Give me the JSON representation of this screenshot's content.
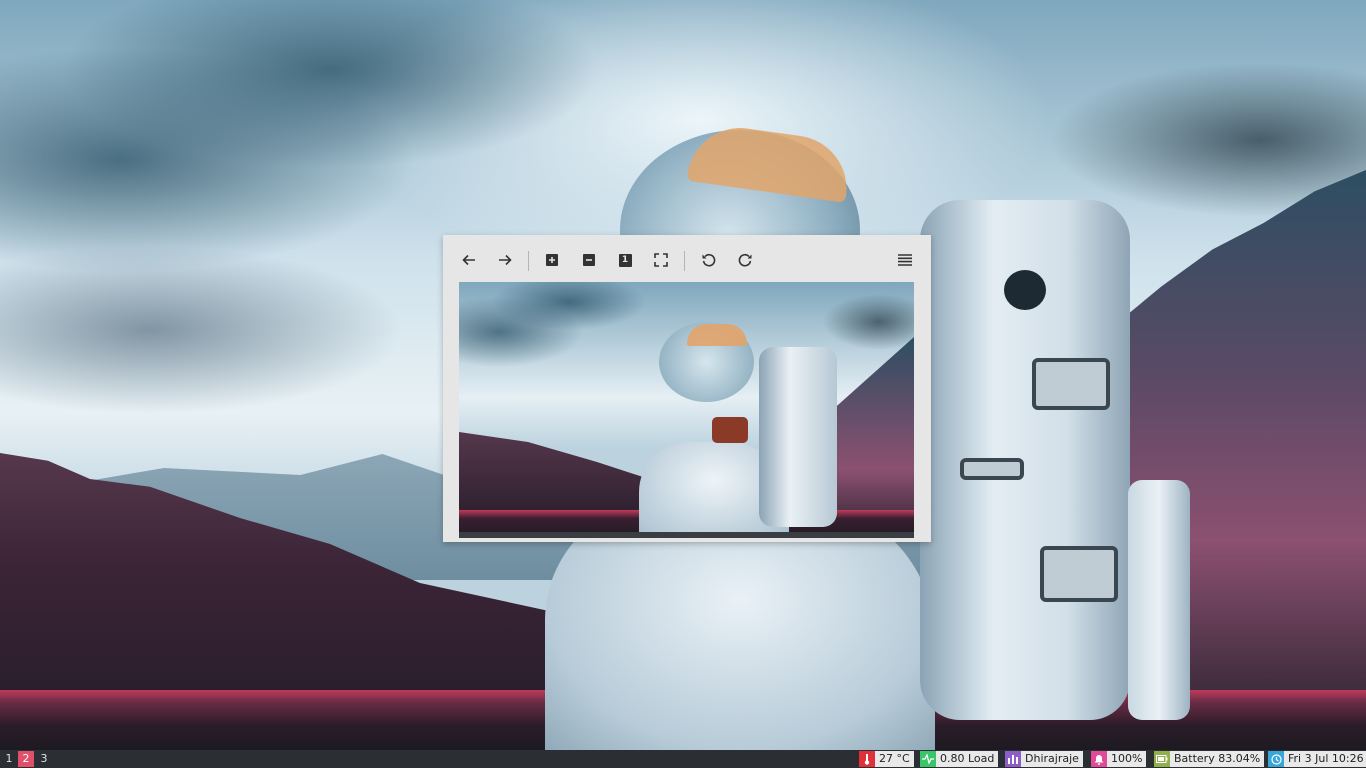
{
  "viewer": {
    "toolbar": {
      "back_icon": "arrow-left-icon",
      "forward_icon": "arrow-right-icon",
      "zoom_in_icon": "zoom-in-icon",
      "zoom_out_icon": "zoom-out-icon",
      "original_size_label": "1",
      "fit_icon": "fullscreen-icon",
      "rotate_left_icon": "rotate-left-icon",
      "rotate_right_icon": "rotate-right-icon",
      "menu_icon": "menu-icon"
    }
  },
  "panel": {
    "workspaces": [
      {
        "label": "1",
        "active": false
      },
      {
        "label": "2",
        "active": true
      },
      {
        "label": "3",
        "active": false
      }
    ],
    "temperature": {
      "text": "27 °C",
      "color": "#e0303a",
      "icon": "thermometer-icon"
    },
    "load": {
      "text": "0.80 Load",
      "color": "#3cc46b",
      "icon": "pulse-icon"
    },
    "user": {
      "text": "Dhirajraje",
      "color": "#8e5ec8",
      "icon": "bar-chart-icon"
    },
    "volume": {
      "text": "100%",
      "color": "#e04a98",
      "icon": "bell-icon"
    },
    "battery": {
      "text": "Battery 83.04%",
      "color": "#8fb04a",
      "icon": "battery-icon"
    },
    "clock": {
      "text": "Fri 3 Jul 10:26",
      "color": "#36a7d8",
      "icon": "clock-icon"
    },
    "accent": "#e0506a"
  }
}
